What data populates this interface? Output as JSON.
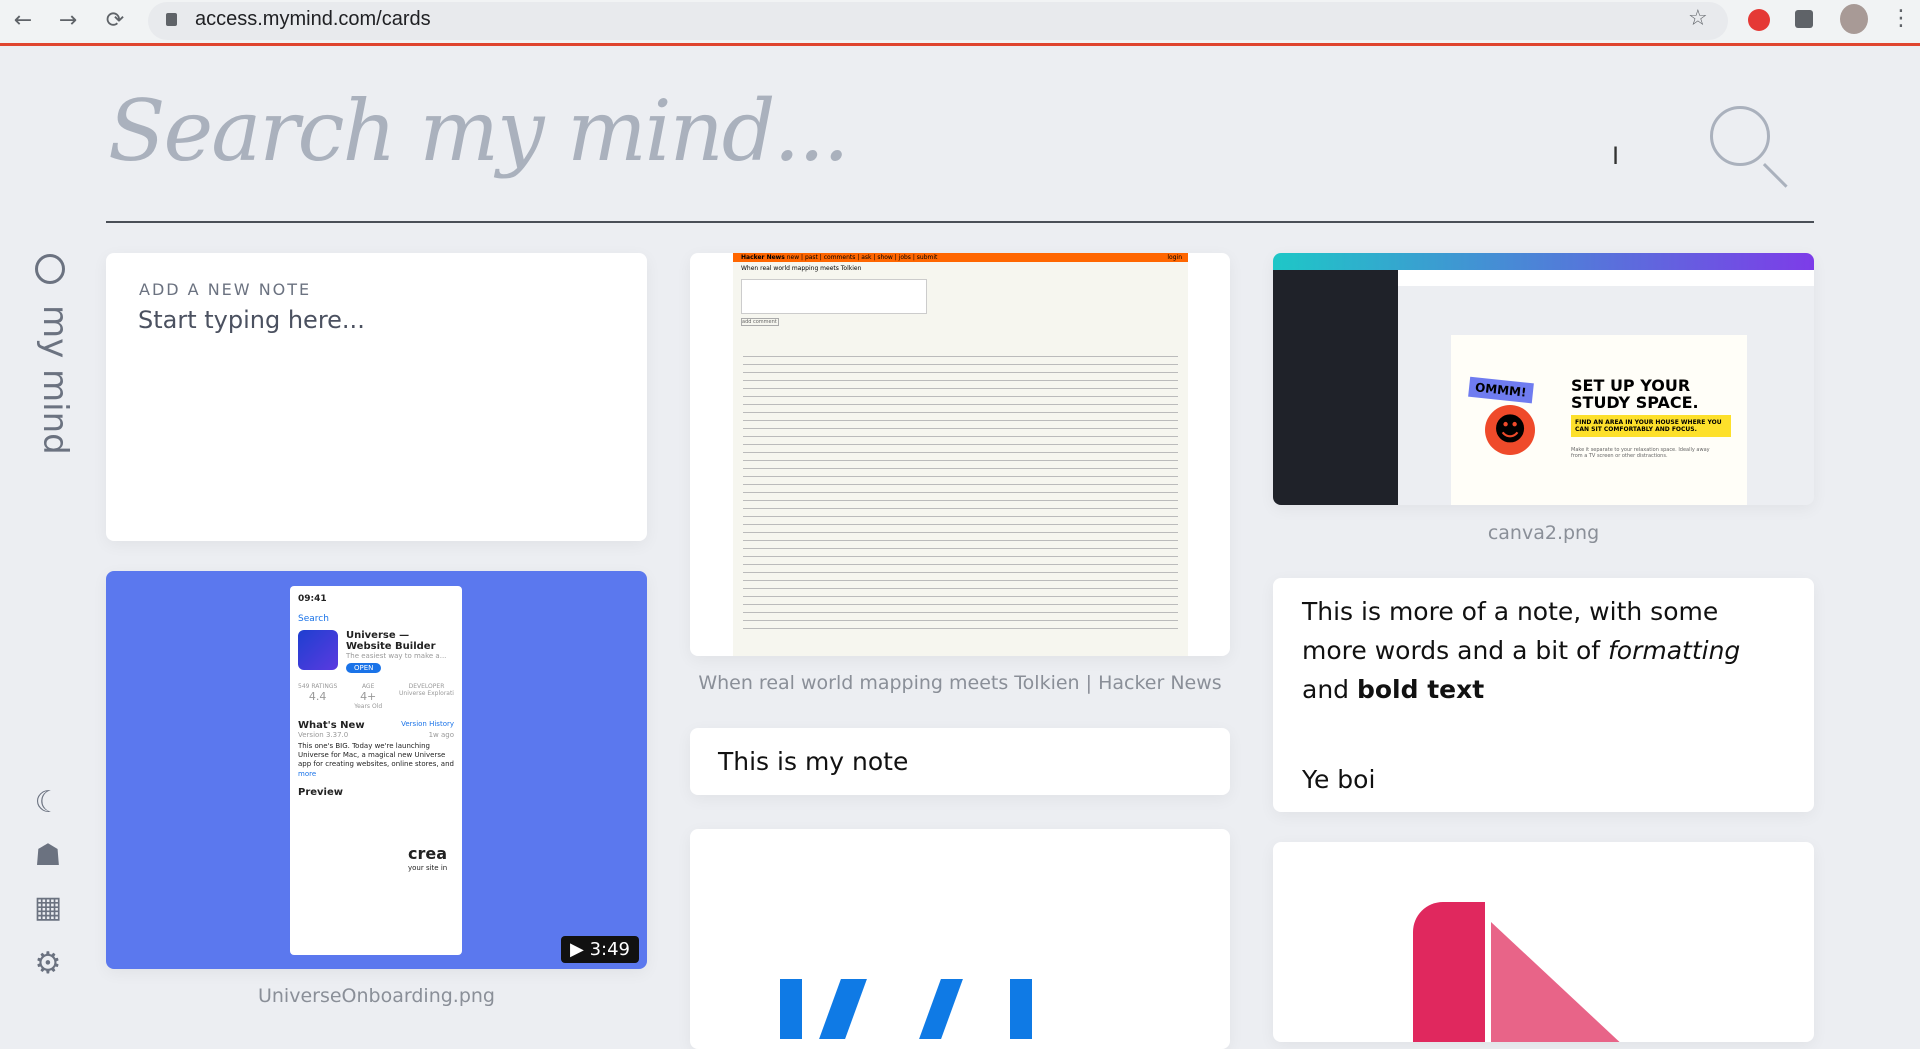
{
  "browser": {
    "url": "access.mymind.com/cards",
    "back": "←",
    "forward": "→",
    "reload": "⟳",
    "star": "☆",
    "menu": "⋮"
  },
  "search": {
    "placeholder": "Search my mind..."
  },
  "sidebar": {
    "brand": "my mind",
    "icons": [
      "moon-icon",
      "head-icon",
      "grid-icon",
      "gear-icon"
    ]
  },
  "cards": {
    "new_note": {
      "label": "ADD A NEW NOTE",
      "placeholder": "Start typing here..."
    },
    "universe": {
      "caption": "UniverseOnboarding.png",
      "duration": "3:49",
      "bg": "#5b78ee",
      "app": {
        "time": "09:41",
        "back": "Search",
        "name": "Universe —\nWebsite Builder",
        "subtitle": "The easiest way to make a...",
        "open": "OPEN",
        "ratings_label": "549 RATINGS",
        "rating": "4.4",
        "age_label": "AGE",
        "age": "4+",
        "age_sub": "Years Old",
        "dev_label": "DEVELOPER",
        "dev": "Universe Explorati",
        "whats_new": "What's New",
        "version_history": "Version History",
        "version": "Version 3.37.0",
        "ago": "1w ago",
        "desc": "This one's BIG. Today we're launching Universe for Mac, a magical new Universe app for creating websites, online stores, and so much more",
        "more": "more",
        "preview": "Preview",
        "crea": "crea",
        "crea_sub": "your site in"
      }
    },
    "hn": {
      "caption": "When real world mapping meets Tolkien | Hacker News",
      "header": "Hacker News",
      "nav": "new | past | comments | ask | show | jobs | submit",
      "login": "login",
      "title": "When real world mapping meets Tolkien",
      "button": "add comment"
    },
    "my_note": {
      "text": "This is my note"
    },
    "canva": {
      "caption": "canva2.png",
      "headline": "SET UP YOUR STUDY SPACE.",
      "sub": "FIND AN AREA IN YOUR HOUSE WHERE YOU CAN SIT COMFORTABLY AND FOCUS.",
      "sticker": "OMMM!",
      "body": "Make it separate to your relaxation space. Ideally away from a TV screen or other distractions."
    },
    "rich_note": {
      "line1": "This is more of a note, with some more words and a bit of ",
      "italic": "formatting",
      "mid": " and ",
      "bold": "bold text",
      "line2": "Ye boi"
    }
  }
}
